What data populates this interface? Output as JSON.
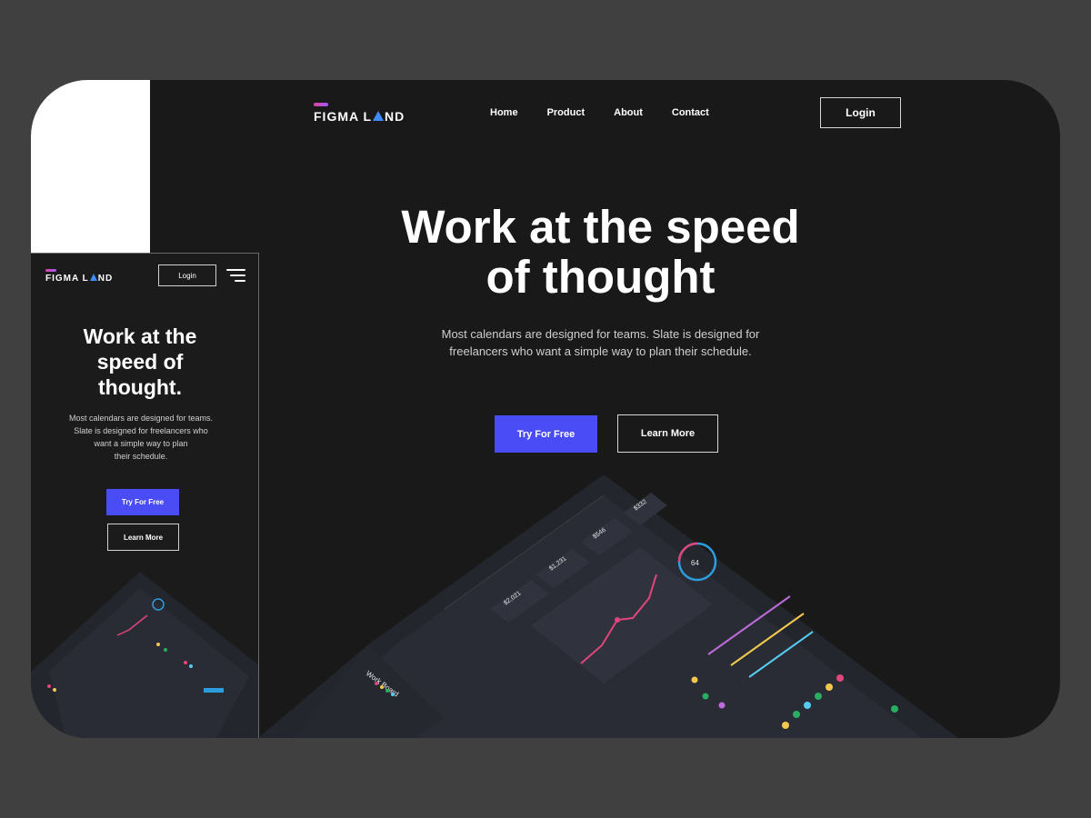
{
  "brand": {
    "name_part1": "FIGMA L",
    "name_part2": "ND",
    "logo_icon": "triangle-a-icon",
    "bar_gradient": [
      "#e040a0",
      "#9b5cf6"
    ],
    "triangle_color": "#3d8bff"
  },
  "desktop": {
    "nav": [
      {
        "label": "Home"
      },
      {
        "label": "Product"
      },
      {
        "label": "About"
      },
      {
        "label": "Contact"
      }
    ],
    "login_label": "Login",
    "hero": {
      "title_line1": "Work at the speed",
      "title_line2": "of thought",
      "subtitle_line1": "Most calendars are designed for teams. Slate is designed for",
      "subtitle_line2": "freelancers who want a simple way to plan their schedule."
    },
    "cta_primary": "Try For Free",
    "cta_secondary": "Learn More"
  },
  "mobile": {
    "login_label": "Login",
    "menu_icon": "hamburger-menu-icon",
    "title_line1": "Work at the",
    "title_line2": "speed of",
    "title_line3": "thought.",
    "subtitle_line1": "Most calendars are designed for teams.",
    "subtitle_line2": "Slate is designed for freelancers who",
    "subtitle_line3": "want a simple way to plan",
    "subtitle_line4": "their schedule.",
    "cta_primary": "Try For Free",
    "cta_secondary": "Learn More"
  },
  "dashboard_art": {
    "stats": [
      "$2,021",
      "$1,231",
      "$546",
      "$332"
    ],
    "gauge_value": "64",
    "board_title": "Work Board",
    "accent_colors": [
      "#e0457b",
      "#f2c94c",
      "#27ae60",
      "#56ccf2",
      "#bb6bd9",
      "#2d9cdb"
    ]
  },
  "colors": {
    "accent": "#4a4df5",
    "background": "#191919",
    "page_bg": "#404040"
  }
}
